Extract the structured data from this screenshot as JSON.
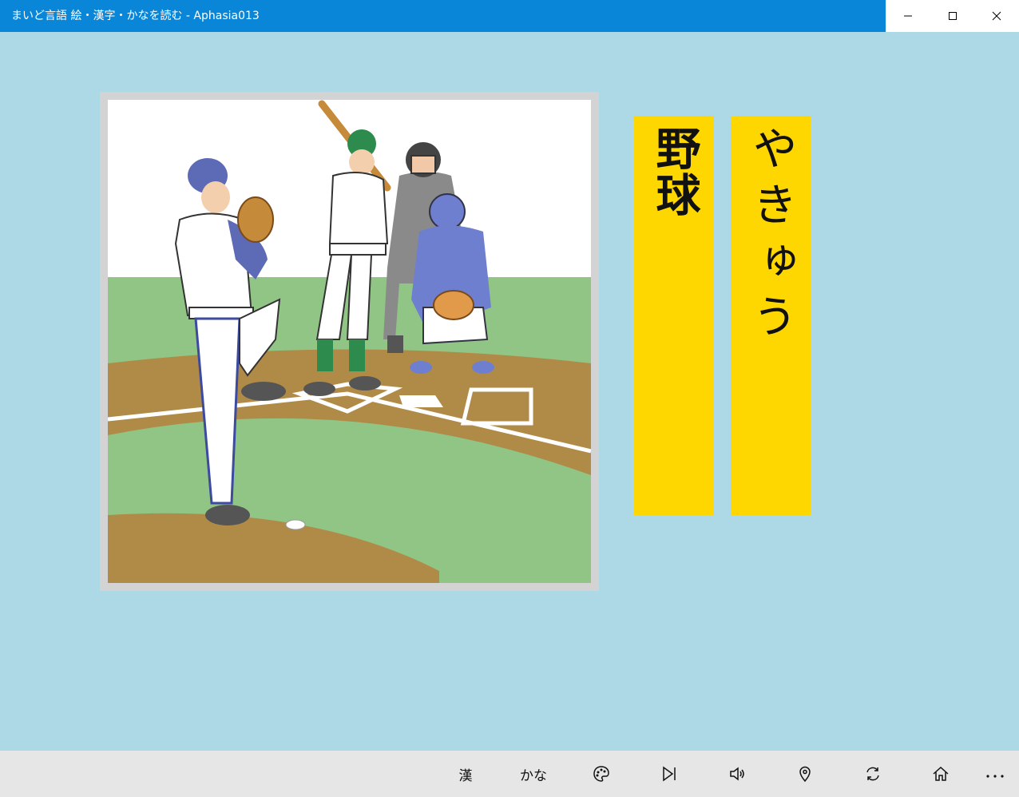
{
  "window": {
    "title": "まいど言語 絵・漢字・かなを読む - Aphasia013",
    "controls": [
      "minimize-icon",
      "maximize-icon",
      "close-icon"
    ]
  },
  "card": {
    "kanji": "野球",
    "kana": "やきゅう"
  },
  "appbar": {
    "kanji_label": "漢",
    "kana_label": "かな",
    "icons": [
      "palette-icon",
      "next-icon",
      "speaker-icon",
      "location-icon",
      "refresh-icon",
      "home-icon",
      "more-icon"
    ]
  },
  "colors": {
    "background": "#add8e6",
    "titlebar": "#0a86d8",
    "card": "#ffd700",
    "appbar": "#e6e6e6"
  }
}
